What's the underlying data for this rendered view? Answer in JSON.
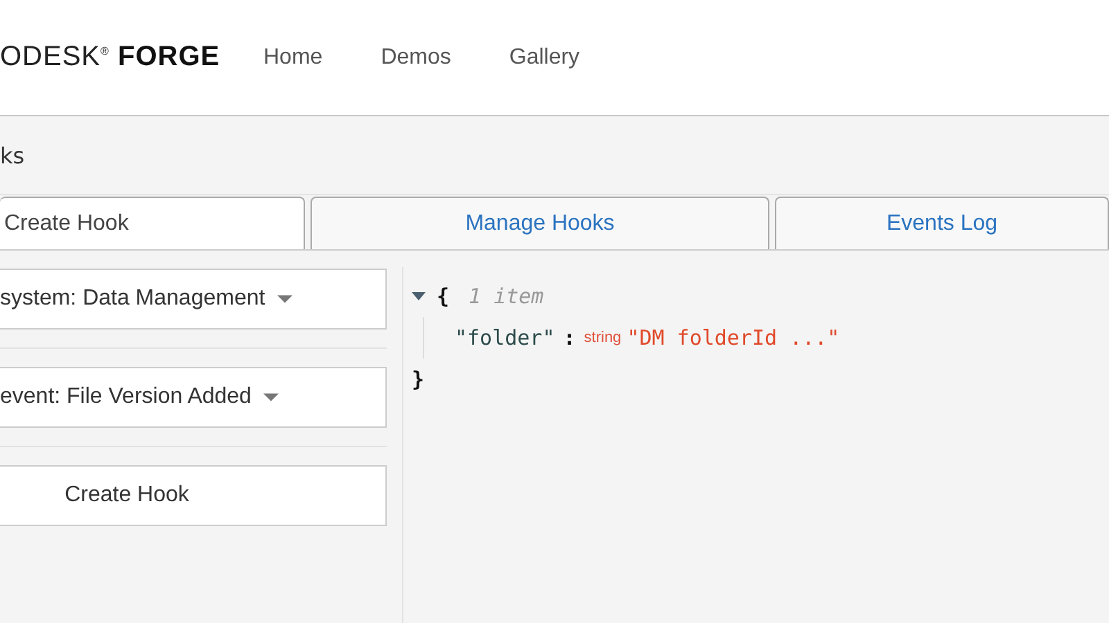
{
  "header": {
    "logo": "ODESK$^{®}$ **FORGE**",
    "nav": [
      {
        "label": "Home"
      },
      {
        "label": "Demos"
      },
      {
        "label": "Gallery"
      }
    ]
  },
  "page_title": "ks",
  "tabs": [
    {
      "label": "Create Hook",
      "selected": true
    },
    {
      "label": "Manage Hooks",
      "selected": false
    },
    {
      "label": "Events Log",
      "selected": false
    }
  ],
  "form": {
    "dropdowns": [
      {
        "value": "system: Data Management"
      },
      {
        "value": "event: File Version Added"
      }
    ],
    "button": "Create Hook"
  },
  "json_viewer": {
    "expanded": true,
    "open_brace": "{",
    "count": "1 item",
    "entries": [
      {
        "key": "\"folder\"",
        "separator": ":",
        "type": "string",
        "value": "\"DM folderId ...\""
      }
    ],
    "close_brace": "}"
  }
}
